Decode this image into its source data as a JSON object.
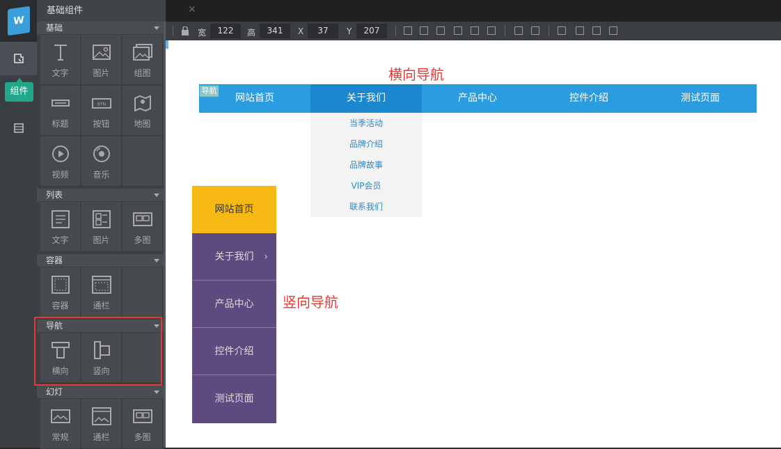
{
  "app": {
    "logo_text": "W",
    "rail": {
      "components_label": "组件"
    }
  },
  "panel": {
    "title": "基础组件",
    "sections": [
      {
        "title": "基础",
        "tiles": [
          "文字",
          "图片",
          "组图",
          "标题",
          "按钮",
          "地图",
          "视频",
          "音乐"
        ]
      },
      {
        "title": "列表",
        "tiles": [
          "文字",
          "图片",
          "多图"
        ]
      },
      {
        "title": "容器",
        "tiles": [
          "容器",
          "通栏"
        ]
      },
      {
        "title": "导航",
        "tiles": [
          "横向",
          "竖向"
        ]
      },
      {
        "title": "幻灯",
        "tiles": [
          "常规",
          "通栏",
          "多图"
        ]
      }
    ],
    "button_icon_text": "BTN"
  },
  "toolbar": {
    "width_label": "宽",
    "width_value": "122",
    "height_label": "高",
    "height_value": "341",
    "x_label": "X",
    "x_value": "37",
    "y_label": "Y",
    "y_value": "207"
  },
  "canvas": {
    "h_title": "横向导航",
    "v_title": "竖向导航",
    "hnav": {
      "badge": "导航",
      "items": [
        "网站首页",
        "关于我们",
        "产品中心",
        "控件介绍",
        "测试页面"
      ],
      "dropdown": [
        "当季活动",
        "品牌介绍",
        "品牌故事",
        "VIP会员",
        "联系我们"
      ]
    },
    "vnav": {
      "items": [
        "网站首页",
        "关于我们",
        "产品中心",
        "控件介绍",
        "测试页面"
      ],
      "arrow": "›"
    }
  },
  "colors": {
    "accent_blue": "#2a9ce0",
    "accent_green": "#22a78a",
    "vnav_active": "#f7b913",
    "vnav_bg": "#5e4a7e",
    "annotation_red": "#e53935"
  }
}
